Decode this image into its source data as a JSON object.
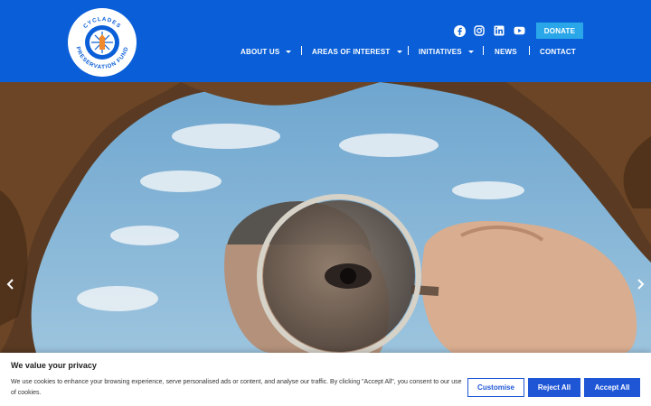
{
  "header": {
    "logo": {
      "name": "cycladies-preservation-fund-logo",
      "text_top": "CYCLADES",
      "text_bottom": "PRESERVATION FUND"
    },
    "social": [
      "facebook-icon",
      "instagram-icon",
      "linkedin-icon",
      "youtube-icon"
    ],
    "donate_label": "DONATE",
    "nav": [
      {
        "label": "ABOUT US",
        "has_dropdown": true
      },
      {
        "label": "AREAS OF INTEREST",
        "has_dropdown": true
      },
      {
        "label": "INITIATIVES",
        "has_dropdown": true
      },
      {
        "label": "NEWS",
        "has_dropdown": false
      },
      {
        "label": "CONTACT",
        "has_dropdown": false
      }
    ],
    "colors": {
      "header_bg": "#0a5fd8",
      "donate_bg": "#2aa7e8"
    }
  },
  "hero": {
    "image": "person-with-magnifying-glass-through-rock-opening",
    "prev_icon": "chevron-left-icon",
    "next_icon": "chevron-right-icon"
  },
  "cookie": {
    "title": "We value your privacy",
    "text": "We use cookies to enhance your browsing experience, serve personalised ads or content, and analyse our traffic. By clicking \"Accept All\", you consent to our use of cookies.",
    "customise_label": "Customise",
    "reject_label": "Reject All",
    "accept_label": "Accept All",
    "accent": "#1f56d6"
  }
}
